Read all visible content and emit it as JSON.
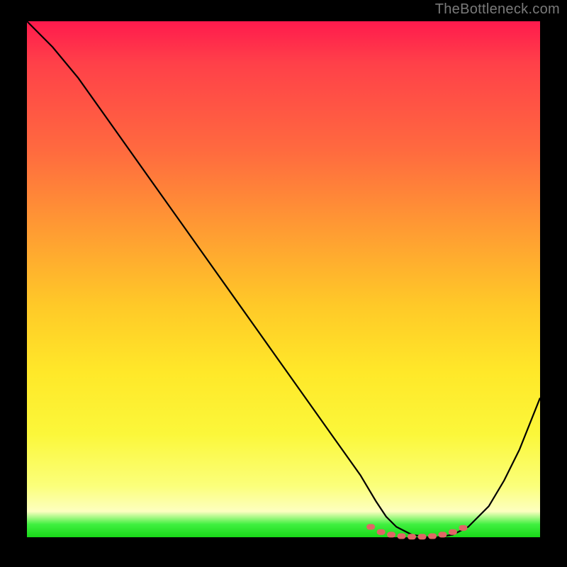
{
  "attribution": "TheBottleneck.com",
  "chart_data": {
    "type": "line",
    "title": "",
    "xlabel": "",
    "ylabel": "",
    "ylim": [
      0,
      100
    ],
    "xlim": [
      0,
      100
    ],
    "series": [
      {
        "name": "bottleneck-curve",
        "x": [
          0,
          5,
          10,
          15,
          20,
          25,
          30,
          35,
          40,
          45,
          50,
          55,
          60,
          65,
          68,
          70,
          72,
          75,
          78,
          80,
          83,
          86,
          90,
          93,
          96,
          100
        ],
        "values": [
          100,
          95,
          89,
          82,
          75,
          68,
          61,
          54,
          47,
          40,
          33,
          26,
          19,
          12,
          7,
          4,
          2,
          0.5,
          0,
          0,
          0.5,
          2,
          6,
          11,
          17,
          27
        ]
      }
    ],
    "basin_markers": {
      "name": "optimal-range-dotted",
      "x": [
        67,
        69,
        71,
        73,
        75,
        77,
        79,
        81,
        83,
        85
      ],
      "values": [
        2.0,
        1.0,
        0.5,
        0.2,
        0.1,
        0.1,
        0.2,
        0.5,
        1.0,
        1.8
      ]
    },
    "gradient_stops": [
      {
        "pos": 0,
        "color": "#ff1a4d"
      },
      {
        "pos": 0.25,
        "color": "#ff6a3f"
      },
      {
        "pos": 0.55,
        "color": "#ffc928"
      },
      {
        "pos": 0.8,
        "color": "#fbf73a"
      },
      {
        "pos": 0.95,
        "color": "#fdffc0"
      },
      {
        "pos": 1.0,
        "color": "#18d818"
      }
    ]
  }
}
